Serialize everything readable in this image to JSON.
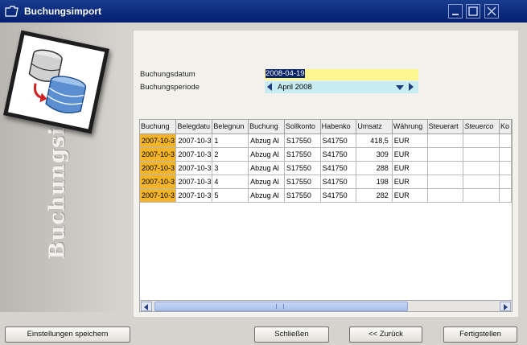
{
  "window": {
    "title": "Buchungsimport"
  },
  "sidebar": {
    "vertical_title": "Buchungsimport"
  },
  "form": {
    "buchungsdatum_label": "Buchungsdatum",
    "buchungsdatum_value": "2008-04-19",
    "buchungsperiode_label": "Buchungsperiode",
    "buchungsperiode_value": "April 2008"
  },
  "grid": {
    "columns": [
      "Buchung",
      "Belegdatu",
      "Belegnun",
      "Buchung",
      "Sollkonto",
      "Habenko",
      "Umsatz",
      "Währung",
      "Steuerart",
      "Steuerco",
      "Ko"
    ],
    "rows": [
      [
        "2007-10-3",
        "2007-10-3",
        "1",
        "Abzug Al",
        "S17550",
        "S41750",
        "418,5",
        "EUR",
        "",
        "",
        ""
      ],
      [
        "2007-10-3",
        "2007-10-3",
        "2",
        "Abzug Al",
        "S17550",
        "S41750",
        "309",
        "EUR",
        "",
        "",
        ""
      ],
      [
        "2007-10-3",
        "2007-10-3",
        "3",
        "Abzug Al",
        "S17550",
        "S41750",
        "288",
        "EUR",
        "",
        "",
        ""
      ],
      [
        "2007-10-3",
        "2007-10-3",
        "4",
        "Abzug Al",
        "S17550",
        "S41750",
        "198",
        "EUR",
        "",
        "",
        ""
      ],
      [
        "2007-10-3",
        "2007-10-3",
        "5",
        "Abzug Al",
        "S17550",
        "S41750",
        "282",
        "EUR",
        "",
        "",
        ""
      ]
    ]
  },
  "buttons": {
    "save_settings": "Einstellungen speichern",
    "close": "Schließen",
    "back": "<< Zurück",
    "finish": "Fertigstellen"
  },
  "colors": {
    "titlebar": "#0a2a7a",
    "date_input_bg": "#fff68f",
    "periode_bg": "#c7ecf2",
    "first_column_highlight": "#f4b428"
  }
}
